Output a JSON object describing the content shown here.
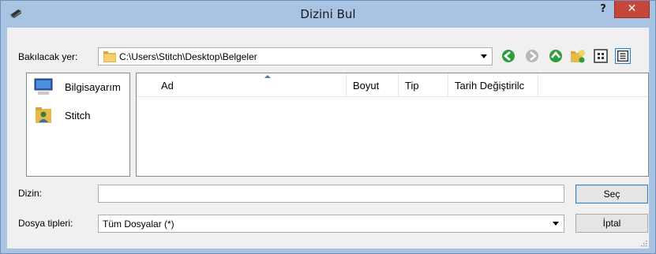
{
  "window": {
    "title": "Dizini Bul",
    "help_label": "?",
    "close_label": "✕"
  },
  "lookin": {
    "label": "Bakılacak yer:",
    "path": "C:\\Users\\Stitch\\Desktop\\Belgeler"
  },
  "toolbar": {
    "icons": [
      "back-icon",
      "forward-icon",
      "up-folder-icon",
      "new-folder-icon",
      "view-icons-icon",
      "view-details-icon"
    ]
  },
  "places": [
    {
      "label": "Bilgisayarım",
      "icon": "computer-icon"
    },
    {
      "label": "Stitch",
      "icon": "user-folder-icon"
    }
  ],
  "filelist": {
    "columns": [
      "Ad",
      "Boyut",
      "Tip",
      "Tarih Değiştirilc"
    ]
  },
  "directory": {
    "label": "Dizin:",
    "value": "",
    "select_button": "Seç"
  },
  "filetypes": {
    "label": "Dosya tipleri:",
    "selected": "Tüm Dosyalar (*)",
    "cancel_button": "İptal"
  },
  "colors": {
    "titlebar": "#a9c3e3",
    "close": "#c7463c",
    "nav_green": "#2f9e3a"
  }
}
